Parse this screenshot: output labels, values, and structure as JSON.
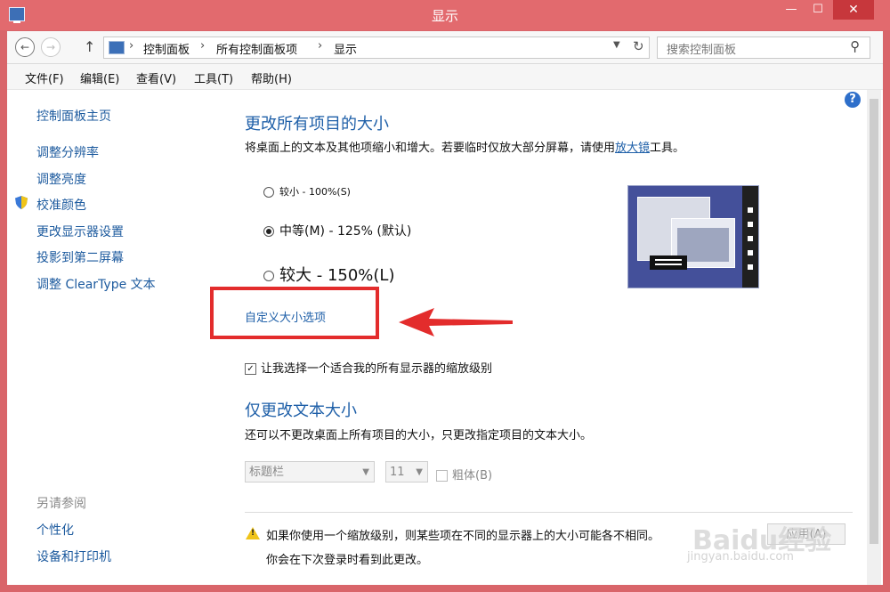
{
  "window": {
    "title": "显示",
    "controls": {
      "min": "—",
      "max": "☐",
      "close": "✕"
    }
  },
  "address": {
    "crumbs": [
      "控制面板",
      "所有控制面板项",
      "显示"
    ],
    "search_placeholder": "搜索控制面板"
  },
  "menu": [
    "文件(F)",
    "编辑(E)",
    "查看(V)",
    "工具(T)",
    "帮助(H)"
  ],
  "sidebar": {
    "home": "控制面板主页",
    "items": [
      "调整分辨率",
      "调整亮度",
      "校准颜色",
      "更改显示器设置",
      "投影到第二屏幕",
      "调整 ClearType 文本"
    ],
    "see_also_title": "另请参阅",
    "see_also": [
      "个性化",
      "设备和打印机"
    ]
  },
  "main": {
    "heading1": "更改所有项目的大小",
    "desc1_before": "将桌面上的文本及其他项缩小和增大。若要临时仅放大部分屏幕，请使用",
    "desc1_link": "放大镜",
    "desc1_after": "工具。",
    "options": [
      {
        "label": "较小 - 100%(S)",
        "selected": false
      },
      {
        "label": "中等(M) - 125% (默认)",
        "selected": true
      },
      {
        "label": "较大 - 150%(L)",
        "selected": false
      }
    ],
    "custom_link": "自定义大小选项",
    "checkbox_label": "让我选择一个适合我的所有显示器的缩放级别",
    "checkbox_checked": true,
    "heading2": "仅更改文本大小",
    "desc2": "还可以不更改桌面上所有项目的大小，只更改指定项目的文本大小。",
    "text_item_select": "标题栏",
    "font_size_select": "11",
    "bold_label": "粗体(B)",
    "warning_line1": "如果你使用一个缩放级别，则某些项在不同的显示器上的大小可能各不相同。",
    "warning_line2": "你会在下次登录时看到此更改。",
    "apply_button": "应用(A)"
  },
  "watermark": {
    "logo": "Baidu经验",
    "url": "jingyan.baidu.com"
  },
  "help_icon_glyph": "?",
  "colors": {
    "titlebar": "#e26a6e",
    "link": "#1e5fa8",
    "annotation": "#e32c2c"
  }
}
